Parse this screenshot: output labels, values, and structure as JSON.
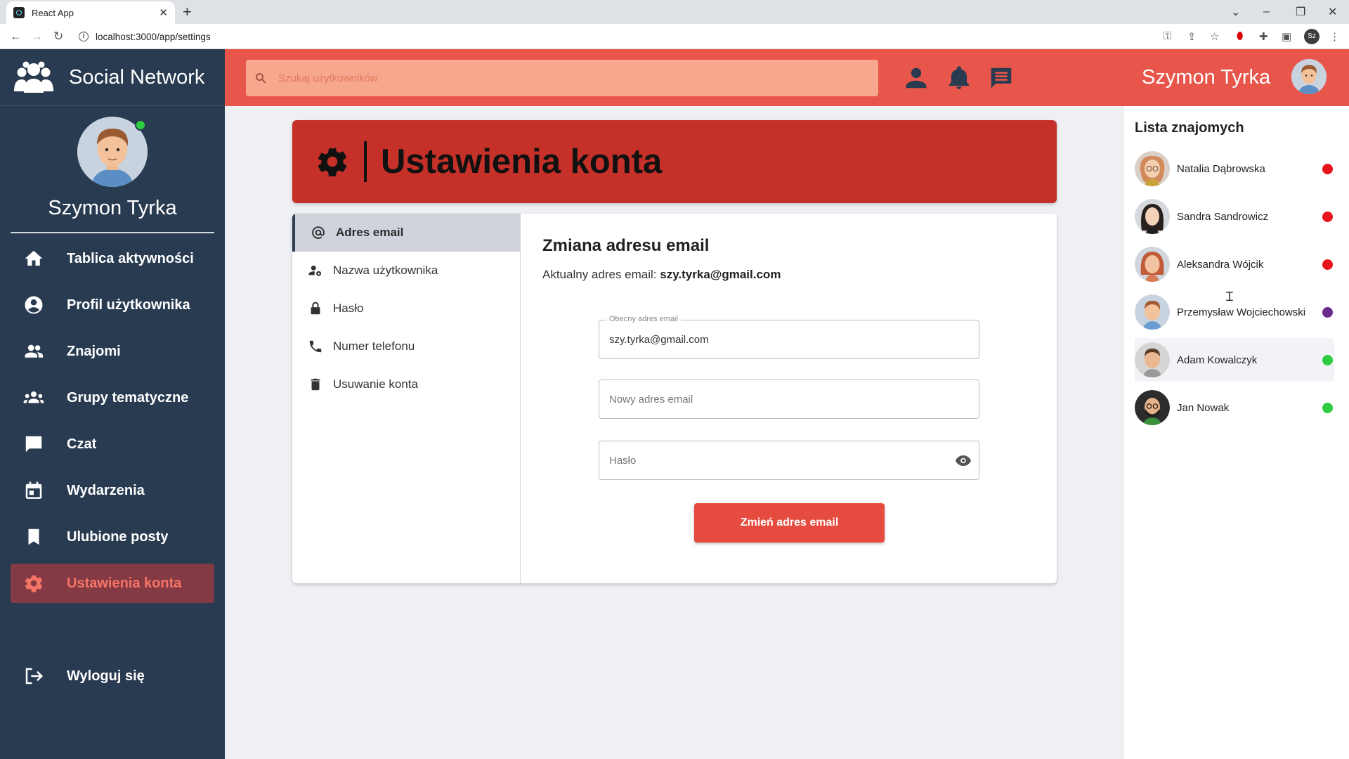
{
  "browser": {
    "tab_title": "React App",
    "tab_close": "✕",
    "new_tab": "+",
    "url": "localhost:3000/app/settings",
    "profile_initials": "Sz"
  },
  "sidebar": {
    "brand": "Social Network",
    "username": "Szymon Tyrka",
    "items": [
      {
        "label": "Tablica aktywności",
        "icon": "home-icon"
      },
      {
        "label": "Profil użytkownika",
        "icon": "account-circle-icon"
      },
      {
        "label": "Znajomi",
        "icon": "people-icon"
      },
      {
        "label": "Grupy tematyczne",
        "icon": "groups-icon"
      },
      {
        "label": "Czat",
        "icon": "chat-bubble-icon"
      },
      {
        "label": "Wydarzenia",
        "icon": "calendar-icon"
      },
      {
        "label": "Ulubione posty",
        "icon": "bookmark-icon"
      },
      {
        "label": "Ustawienia konta",
        "icon": "settings-gear-icon",
        "active": true
      }
    ],
    "logout": "Wyloguj się"
  },
  "topbar": {
    "search_placeholder": "Szukaj użytkowników",
    "username": "Szymon Tyrka"
  },
  "banner": {
    "title": "Ustawienia konta"
  },
  "settings_nav": {
    "items": [
      {
        "label": "Adres email",
        "icon": "at-sign-icon",
        "active": true
      },
      {
        "label": "Nazwa użytkownika",
        "icon": "person-settings-icon"
      },
      {
        "label": "Hasło",
        "icon": "lock-icon"
      },
      {
        "label": "Numer telefonu",
        "icon": "phone-icon"
      },
      {
        "label": "Usuwanie konta",
        "icon": "trash-icon"
      }
    ]
  },
  "form": {
    "title": "Zmiana adresu email",
    "current_label": "Aktualny adres email:",
    "current_value": "szy.tyrka@gmail.com",
    "current_field_label": "Obecny adres email",
    "current_field_value": "szy.tyrka@gmail.com",
    "new_email_placeholder": "Nowy adres email",
    "password_placeholder": "Hasło",
    "submit_label": "Zmień adres email"
  },
  "friends": {
    "title": "Lista znajomych",
    "list": [
      {
        "name": "Natalia Dąbrowska",
        "status_color": "#e8141b"
      },
      {
        "name": "Sandra Sandrowicz",
        "status_color": "#e8141b"
      },
      {
        "name": "Aleksandra Wójcik",
        "status_color": "#e8141b"
      },
      {
        "name": "Przemysław Wojciechowski",
        "status_color": "#6b2b8a"
      },
      {
        "name": "Adam Kowalczyk",
        "status_color": "#2ecc40"
      },
      {
        "name": "Jan Nowak",
        "status_color": "#2ecc40"
      }
    ]
  },
  "colors": {
    "accent": "#e8554a",
    "banner": "#c53128",
    "sidebar": "#293b51",
    "active_menu_bg": "#843a44",
    "active_menu_text": "#f57466",
    "online": "#2ecc40"
  }
}
